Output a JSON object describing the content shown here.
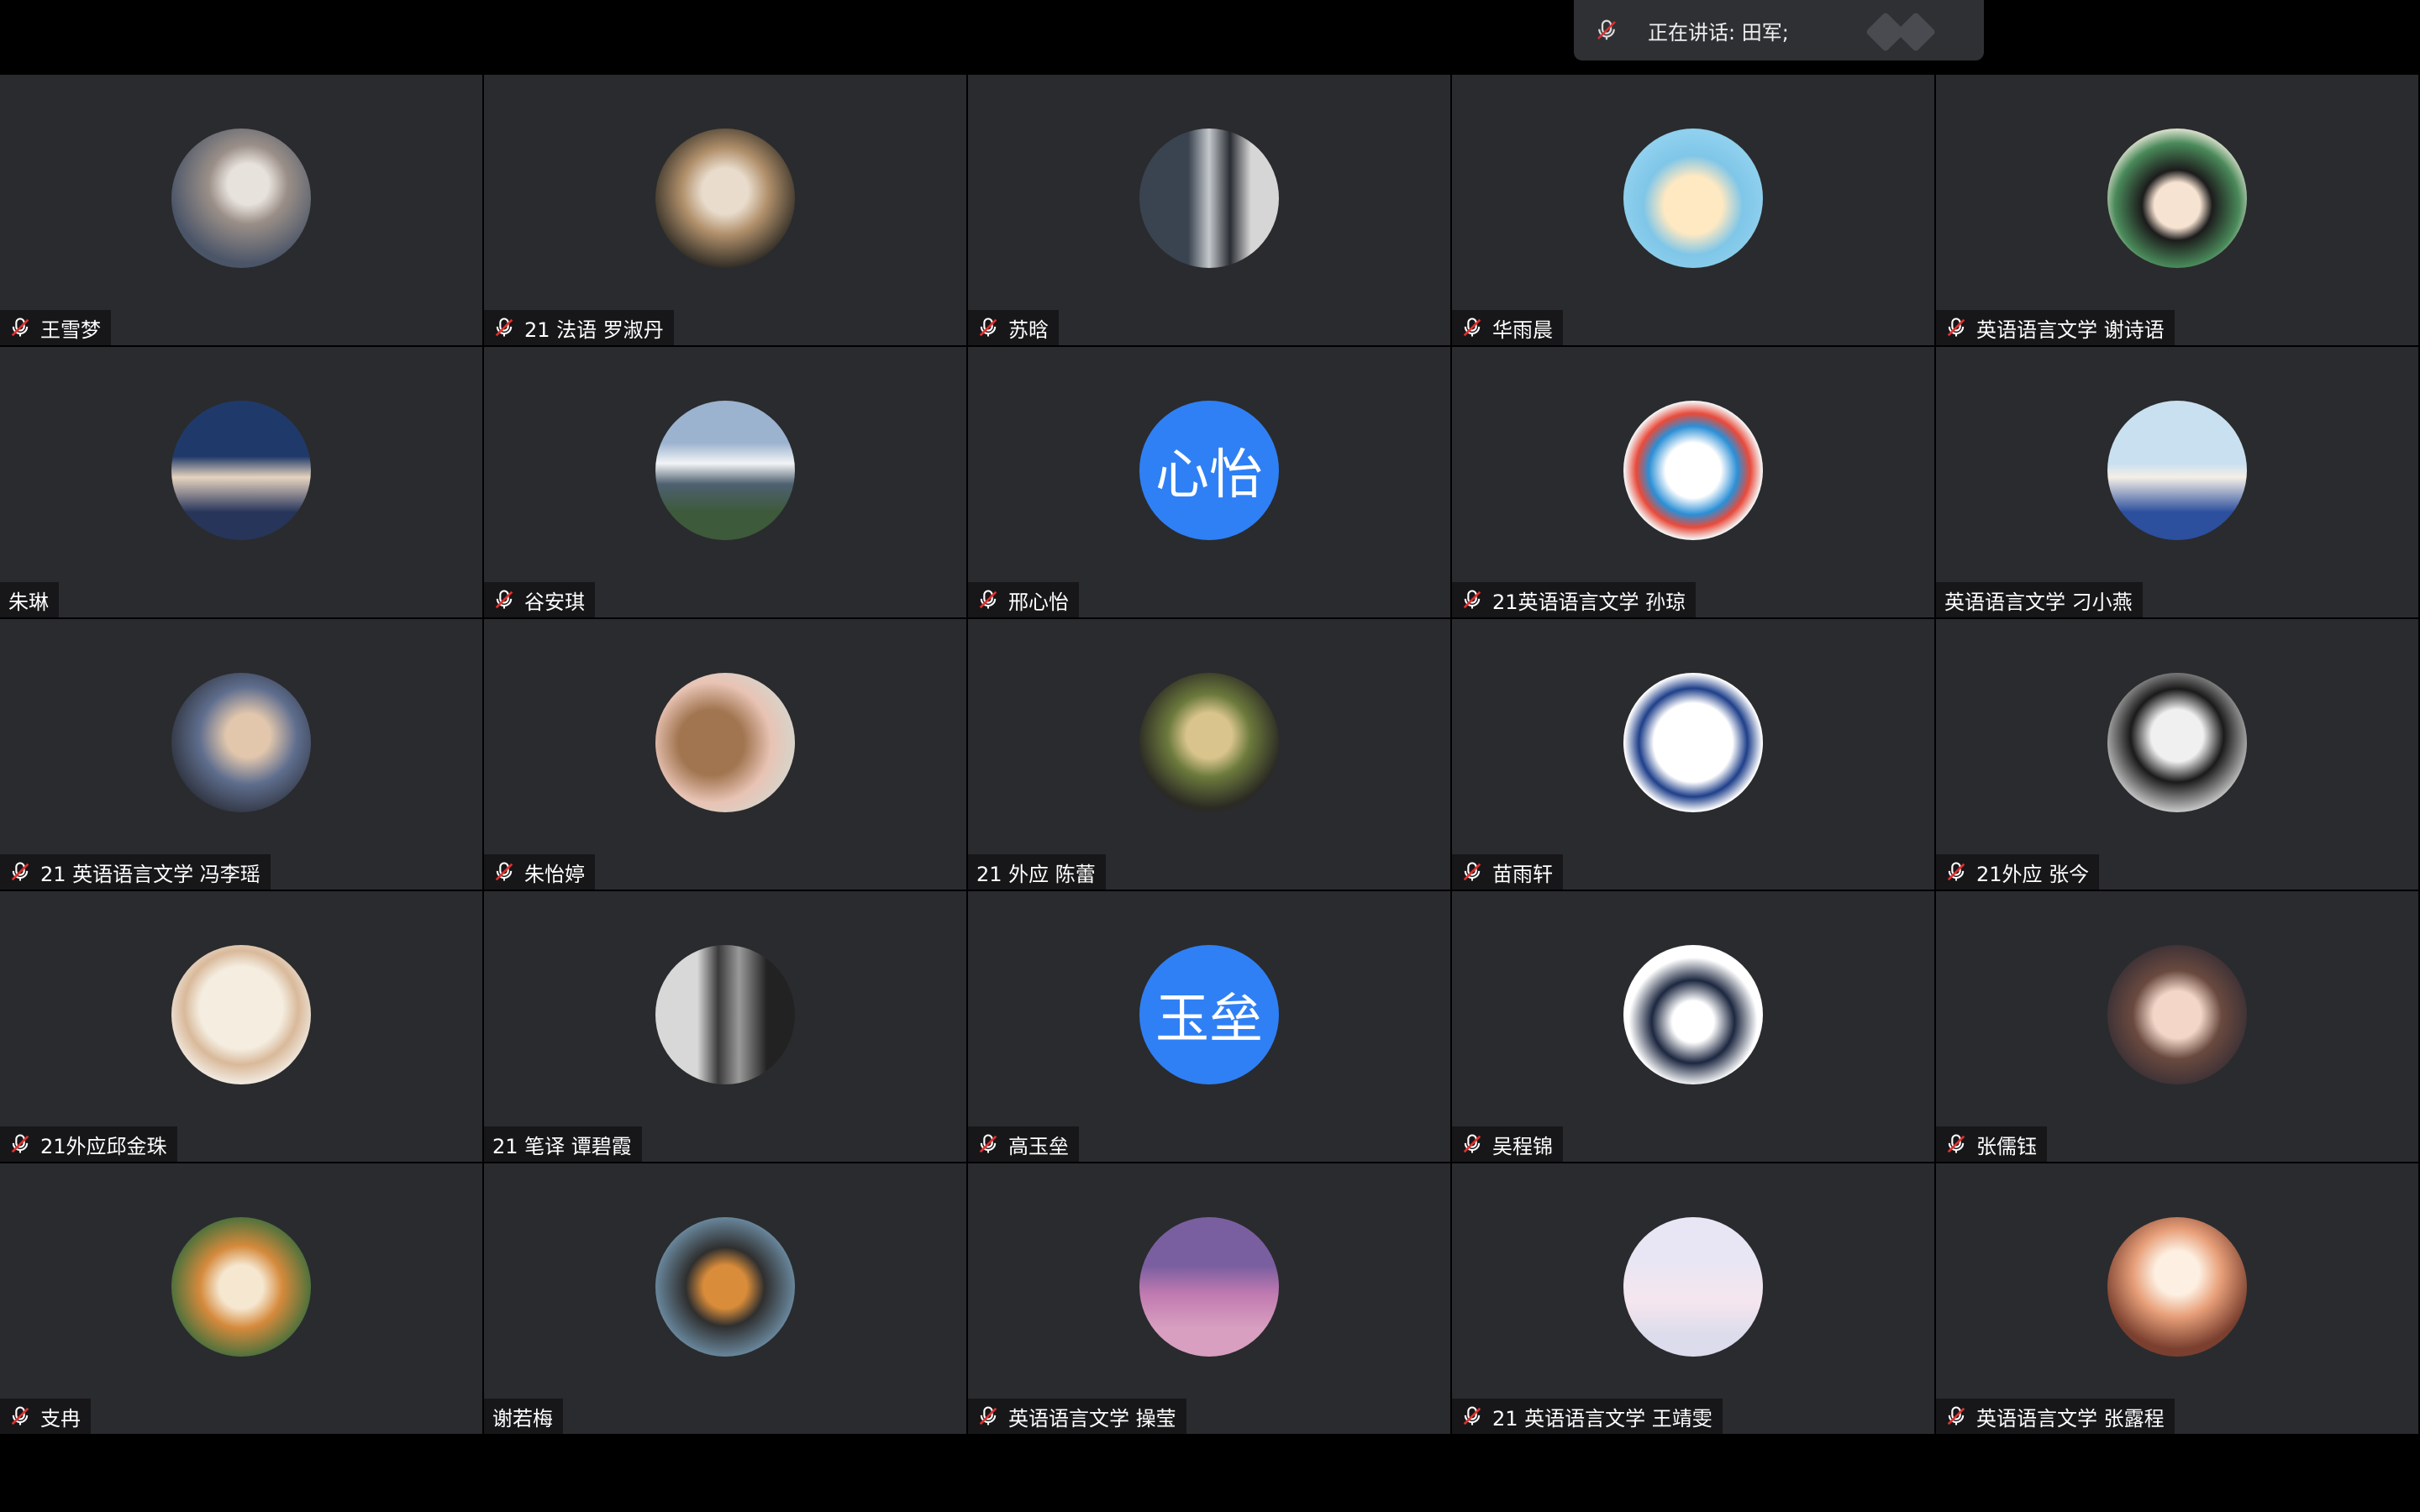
{
  "speaking": {
    "text": "正在讲话: 田军;"
  },
  "participants": [
    {
      "name": "王雪梦",
      "muted": true,
      "avatar": {
        "type": "photo",
        "bg": "radial-gradient(circle at 55% 40%, #e8e2dc 0 18%, #9a8f88 35%, #4b5568 70%)"
      }
    },
    {
      "name": "21 法语 罗淑丹",
      "muted": true,
      "avatar": {
        "type": "photo",
        "bg": "radial-gradient(circle at 50% 45%, #e9dccc 0 22%, #b08f6a 42%, #2d2a24 75%)"
      }
    },
    {
      "name": "苏晗",
      "muted": true,
      "avatar": {
        "type": "photo",
        "bg": "linear-gradient(90deg, #3a4450 0 35%, #c4c8cc 50%, #2a2d33 65%, #d6d6d6 80%)"
      }
    },
    {
      "name": "华雨晨",
      "muted": true,
      "avatar": {
        "type": "photo",
        "bg": "radial-gradient(circle at 50% 55%, #ffe9c2 0 28%, #7fc6e8 48%, #8fd0ee 70%)"
      }
    },
    {
      "name": "英语语言文学 谢诗语",
      "muted": true,
      "avatar": {
        "type": "photo",
        "bg": "radial-gradient(circle at 50% 55%, #f7e3d1 0 22%, #1c1c1c 34%, #4a8a5a 60%, #e8e8d8 75%)"
      }
    },
    {
      "name": "朱琳",
      "muted": false,
      "avatar": {
        "type": "photo",
        "bg": "linear-gradient(180deg, #1f3a6a 0 40%, #e6d3bf 55%, #27355a 80%)"
      }
    },
    {
      "name": "谷安琪",
      "muted": true,
      "avatar": {
        "type": "photo",
        "bg": "linear-gradient(180deg, #9bb3cf 0 30%, #f2f4f6 45%, #4e6070 60%, #3d5a3a 80%)"
      }
    },
    {
      "name": "邢心怡",
      "muted": true,
      "avatar": {
        "type": "initials",
        "text": "心怡"
      }
    },
    {
      "name": "21英语语言文学 孙琼",
      "muted": true,
      "avatar": {
        "type": "photo",
        "bg": "radial-gradient(circle at 50% 50%, #ffffff 0 28%, #2b8fd6 45%, #e94a3a 58%, #f4f4f4 70%)"
      }
    },
    {
      "name": "英语语言文学 刁小燕",
      "muted": false,
      "avatar": {
        "type": "photo",
        "bg": "linear-gradient(180deg, #c9e0f0 0 45%, #f5efe6 55%, #2c4f9e 80%)"
      }
    },
    {
      "name": "21 英语语言文学 冯李瑶",
      "muted": true,
      "avatar": {
        "type": "photo",
        "bg": "radial-gradient(circle at 55% 45%, #e2c7ad 0 20%, #5f6e8e 45%, #2f3440 75%)"
      }
    },
    {
      "name": "朱怡婷",
      "muted": true,
      "avatar": {
        "type": "photo",
        "bg": "radial-gradient(circle at 40% 50%, #a17550 0 30%, #e8c3b4 55%, #d9d2c8 75%)"
      }
    },
    {
      "name": "21 外应 陈蕾",
      "muted": false,
      "avatar": {
        "type": "photo",
        "bg": "radial-gradient(circle at 50% 45%, #d8c48c 0 22%, #6c7a3c 40%, #2b2a24 70%)"
      }
    },
    {
      "name": "苗雨轩",
      "muted": true,
      "avatar": {
        "type": "photo",
        "bg": "radial-gradient(circle at 50% 50%, #ffffff 0 40%, #1e3f8a 55%, #ffffff 70%)"
      }
    },
    {
      "name": "21外应 张今",
      "muted": true,
      "avatar": {
        "type": "photo",
        "bg": "radial-gradient(circle at 50% 45%, #f0f0f0 0 25%, #1a1a1a 45%, #cfcfcf 75%)"
      }
    },
    {
      "name": "21外应邱金珠",
      "muted": true,
      "avatar": {
        "type": "photo",
        "bg": "radial-gradient(circle at 50% 45%, #f4ede0 0 40%, #d9b99a 55%, #f3eee6 75%)"
      }
    },
    {
      "name": "21 笔译 谭碧霞",
      "muted": false,
      "avatar": {
        "type": "photo",
        "bg": "linear-gradient(90deg, #d8d8d8 0 30%, #3a3a3a 45%, #9a9a9a 60%, #222 80%)"
      }
    },
    {
      "name": "高玉垒",
      "muted": true,
      "avatar": {
        "type": "initials",
        "text": "玉垒"
      }
    },
    {
      "name": "吴程锦",
      "muted": true,
      "avatar": {
        "type": "photo",
        "bg": "radial-gradient(circle at 50% 55%, #ffffff 0 20%, #1c2740 40%, #ffffff 62%)"
      }
    },
    {
      "name": "张儒钰",
      "muted": true,
      "avatar": {
        "type": "photo",
        "bg": "radial-gradient(circle at 50% 50%, #f3d6c8 0 24%, #6a4a3f 45%, #3a2f35 75%)"
      }
    },
    {
      "name": "支冉",
      "muted": true,
      "avatar": {
        "type": "photo",
        "bg": "radial-gradient(circle at 50% 50%, #f6e7d0 0 22%, #d58a3c 42%, #3c6e3c 75%)"
      }
    },
    {
      "name": "谢若梅",
      "muted": false,
      "avatar": {
        "type": "photo",
        "bg": "radial-gradient(circle at 50% 50%, #d98c3a 0 22%, #2f2f2f 40%, #6b8aa0 72%)"
      }
    },
    {
      "name": "英语语言文学 操莹",
      "muted": true,
      "avatar": {
        "type": "photo",
        "bg": "linear-gradient(180deg, #7a5fa0 0 35%, #c07ab0 55%, #d89fc0 80%)"
      }
    },
    {
      "name": "21 英语语言文学 王靖雯",
      "muted": true,
      "avatar": {
        "type": "photo",
        "bg": "linear-gradient(180deg, #e8e6f4 0 30%, #f5e6ee 60%, #dcdcec 85%)"
      }
    },
    {
      "name": "英语语言文学 张露程",
      "muted": true,
      "avatar": {
        "type": "photo",
        "bg": "radial-gradient(circle at 50% 40%, #fdf0e2 0 20%, #e8a07a 40%, #7a3f2f 70%)"
      }
    }
  ]
}
